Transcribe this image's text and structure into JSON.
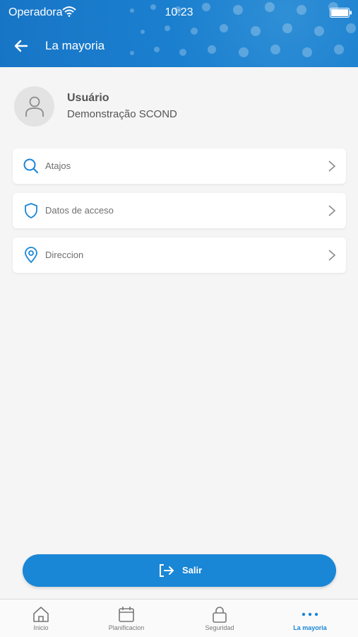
{
  "status_bar": {
    "carrier": "Operadora",
    "time": "10:23"
  },
  "header": {
    "title": "La mayoria"
  },
  "profile": {
    "name": "Usuário",
    "organization": "Demonstração SCOND"
  },
  "menu": [
    {
      "label": "Atajos",
      "icon": "search-icon"
    },
    {
      "label": "Datos de acceso",
      "icon": "shield-icon"
    },
    {
      "label": "Direccion",
      "icon": "location-pin-icon"
    }
  ],
  "logout": {
    "label": "Salir",
    "icon": "logout-icon"
  },
  "tabs": [
    {
      "label": "Inicio",
      "icon": "home-icon",
      "active": false
    },
    {
      "label": "Planificacion",
      "icon": "calendar-icon",
      "active": false
    },
    {
      "label": "Seguridad",
      "icon": "lock-icon",
      "active": false
    },
    {
      "label": "La mayoria",
      "icon": "more-dots-icon",
      "active": true
    }
  ],
  "colors": {
    "accent": "#1a86d6",
    "header": "#1b7fcf",
    "background": "#f5f5f5"
  }
}
